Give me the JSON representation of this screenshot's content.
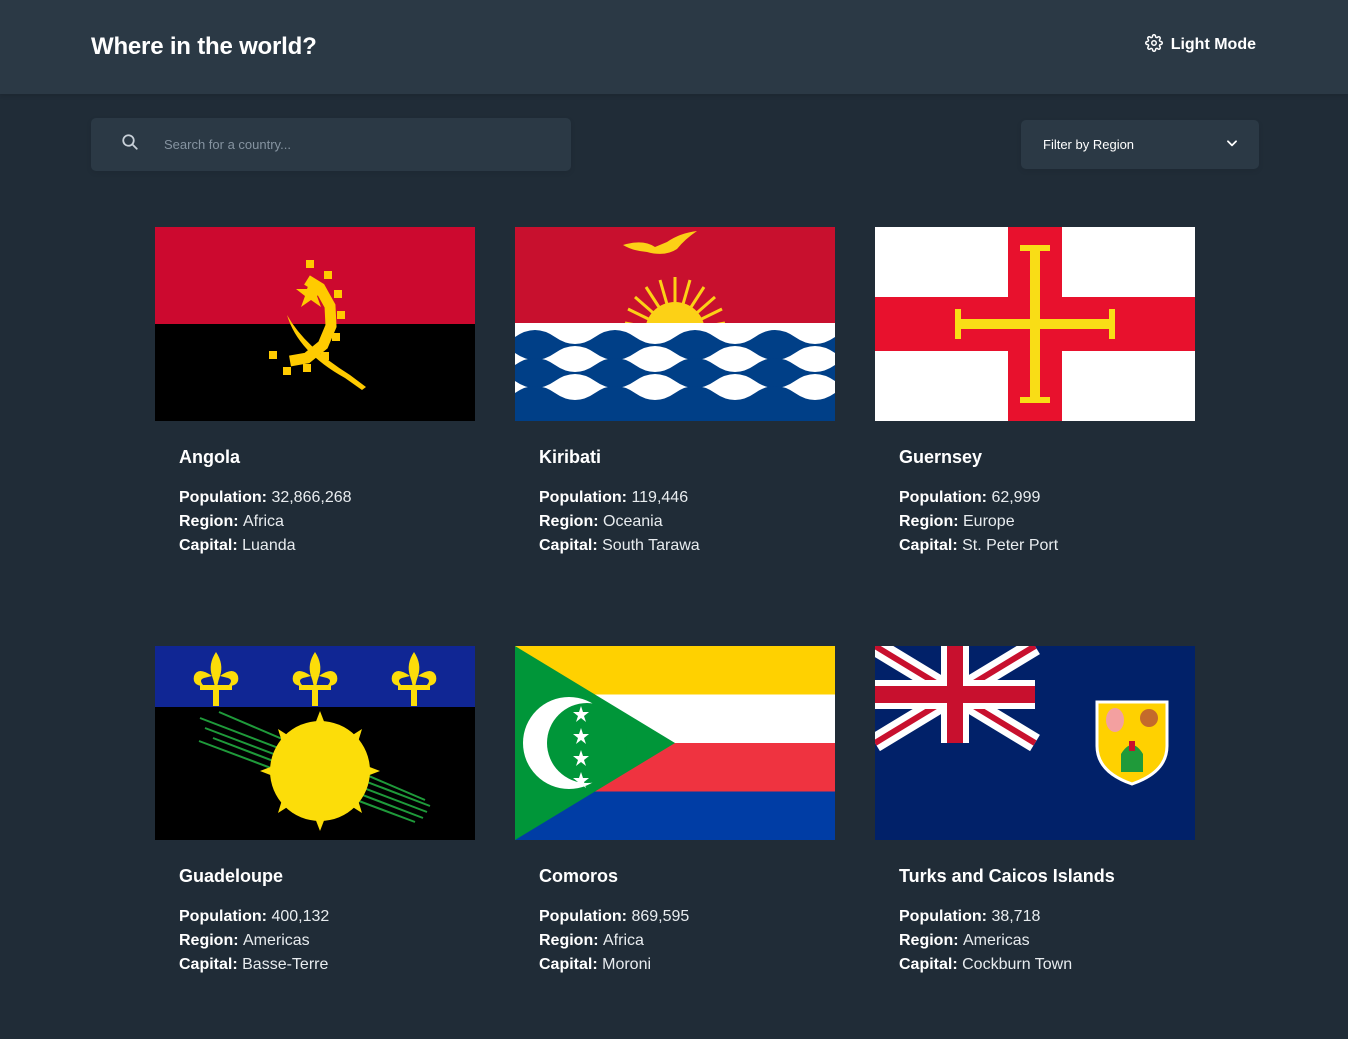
{
  "header": {
    "title": "Where in the world?",
    "theme_toggle_label": "Light Mode",
    "theme_icon": "gear-icon"
  },
  "search": {
    "placeholder": "Search for a country...",
    "value": "",
    "icon": "search-icon"
  },
  "filter": {
    "label": "Filter by Region",
    "icon": "chevron-down-icon"
  },
  "labels": {
    "population": "Population:",
    "region": "Region:",
    "capital": "Capital:"
  },
  "colors": {
    "background": "#202c37",
    "element": "#2b3945",
    "text": "#ffffff"
  },
  "countries": [
    {
      "name": "Angola",
      "population": "32,866,268",
      "region": "Africa",
      "capital": "Luanda",
      "flag": "angola-flag"
    },
    {
      "name": "Kiribati",
      "population": "119,446",
      "region": "Oceania",
      "capital": "South Tarawa",
      "flag": "kiribati-flag"
    },
    {
      "name": "Guernsey",
      "population": "62,999",
      "region": "Europe",
      "capital": "St. Peter Port",
      "flag": "guernsey-flag"
    },
    {
      "name": "Guadeloupe",
      "population": "400,132",
      "region": "Americas",
      "capital": "Basse-Terre",
      "flag": "guadeloupe-flag"
    },
    {
      "name": "Comoros",
      "population": "869,595",
      "region": "Africa",
      "capital": "Moroni",
      "flag": "comoros-flag"
    },
    {
      "name": "Turks and Caicos Islands",
      "population": "38,718",
      "region": "Americas",
      "capital": "Cockburn Town",
      "flag": "turks-and-caicos-flag"
    }
  ]
}
